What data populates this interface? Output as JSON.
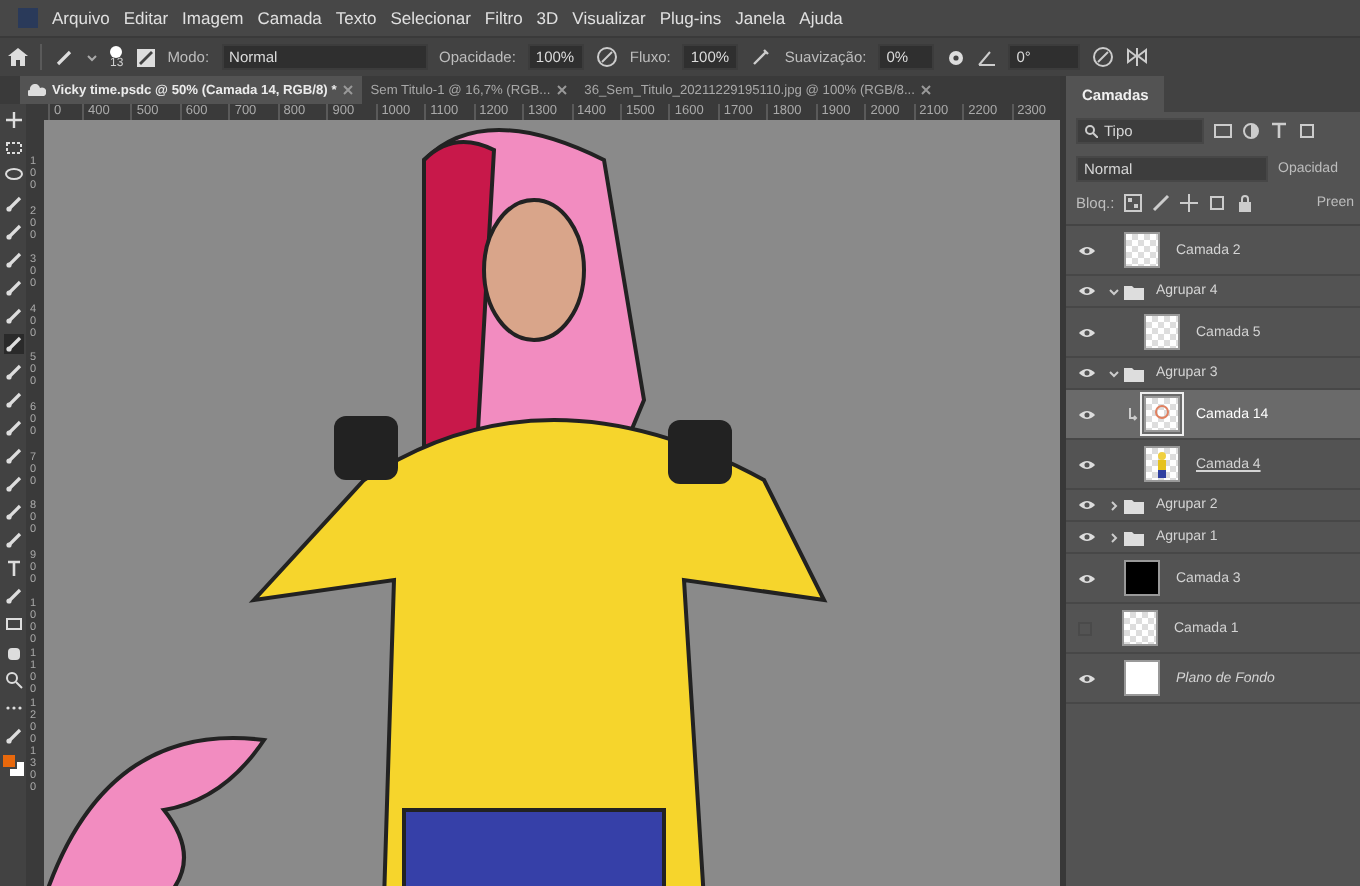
{
  "menu": [
    "Arquivo",
    "Editar",
    "Imagem",
    "Camada",
    "Texto",
    "Selecionar",
    "Filtro",
    "3D",
    "Visualizar",
    "Plug-ins",
    "Janela",
    "Ajuda"
  ],
  "options": {
    "brush_size": "13",
    "mode_label": "Modo:",
    "mode": "Normal",
    "opacity_label": "Opacidade:",
    "opacity": "100%",
    "flow_label": "Fluxo:",
    "flow": "100%",
    "smoothing_label": "Suavização:",
    "smoothing": "0%",
    "angle": "0°"
  },
  "document_tabs": [
    {
      "title": "Vicky time.psdc @ 50% (Camada 14, RGB/8) *",
      "selected": true,
      "kind": "cloud"
    },
    {
      "title": "Sem Titulo-1 @ 16,7% (RGB...",
      "selected": false,
      "kind": "local"
    },
    {
      "title": "36_Sem_Titulo_20211229195110.jpg @ 100% (RGB/8...",
      "selected": false,
      "kind": "local"
    }
  ],
  "ruler": {
    "horizontal": [
      "0",
      "400",
      "500",
      "600",
      "700",
      "800",
      "900",
      "1000",
      "1100",
      "1200",
      "1300",
      "1400",
      "1500",
      "1600",
      "1700",
      "1800",
      "1900",
      "2000",
      "2100",
      "2200",
      "2300"
    ],
    "vertical": [
      "100",
      "200",
      "300",
      "400",
      "500",
      "600",
      "700",
      "800",
      "900",
      "1000",
      "1100",
      "1200",
      "1300"
    ]
  },
  "layers_panel": {
    "title": "Camadas",
    "filter": "Tipo",
    "blend_mode": "Normal",
    "opacity_label": "Opacidad",
    "lock_label": "Bloq.:",
    "fill_label": "Preen",
    "layers": [
      {
        "kind": "layer",
        "name": "Camada 2",
        "visible": true,
        "selected": false,
        "thumbnail": {
          "kind": "transparent"
        },
        "clipped": false,
        "clipping_base": false,
        "background": false
      },
      {
        "kind": "group",
        "name": "Agrupar 4",
        "visible": true,
        "selected": false,
        "expanded": true,
        "children": [
          {
            "kind": "layer",
            "name": "Camada 5",
            "visible": true,
            "selected": false,
            "thumbnail": {
              "kind": "transparent"
            },
            "clipped": false,
            "clipping_base": false,
            "background": false
          }
        ]
      },
      {
        "kind": "group",
        "name": "Agrupar 3",
        "visible": true,
        "selected": false,
        "expanded": true,
        "children": [
          {
            "kind": "layer",
            "name": "Camada 14",
            "visible": true,
            "selected": true,
            "thumbnail": {
              "kind": "sketch"
            },
            "clipped": true,
            "clipping_base": false,
            "background": false
          },
          {
            "kind": "layer",
            "name": "Camada 4",
            "visible": true,
            "selected": false,
            "thumbnail": {
              "kind": "figure"
            },
            "clipped": false,
            "clipping_base": true,
            "background": false
          }
        ]
      },
      {
        "kind": "group",
        "name": "Agrupar 2",
        "visible": true,
        "selected": false,
        "expanded": false
      },
      {
        "kind": "group",
        "name": "Agrupar 1",
        "visible": true,
        "selected": false,
        "expanded": false
      },
      {
        "kind": "layer",
        "name": "Camada 3",
        "visible": true,
        "selected": false,
        "thumbnail": {
          "kind": "black"
        },
        "clipped": false,
        "clipping_base": false,
        "background": false
      },
      {
        "kind": "layer",
        "name": "Camada 1",
        "visible": false,
        "selected": false,
        "thumbnail": {
          "kind": "transparent"
        },
        "clipped": false,
        "clipping_base": false,
        "background": false
      },
      {
        "kind": "layer",
        "name": "Plano de Fondo",
        "visible": true,
        "selected": false,
        "thumbnail": {
          "kind": "white"
        },
        "clipped": false,
        "clipping_base": false,
        "background": true
      }
    ]
  }
}
